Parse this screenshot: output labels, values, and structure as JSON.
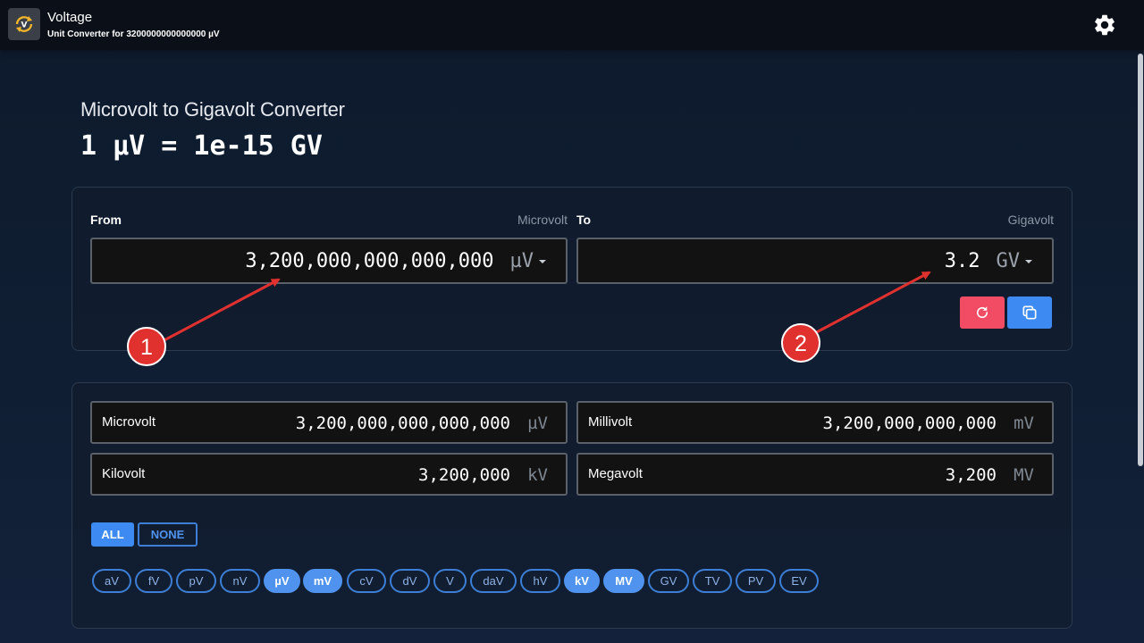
{
  "app": {
    "title": "Voltage",
    "subtitle": "Unit Converter for 3200000000000000 µV",
    "icon": "refresh-bolt-icon"
  },
  "header": {
    "converter_title": "Microvolt to Gigavolt Converter",
    "formula": "1 µV = 1e-15 GV"
  },
  "from": {
    "label": "From",
    "unit_name": "Microvolt",
    "value": "3,200,000,000,000,000",
    "unit": "µV"
  },
  "to": {
    "label": "To",
    "unit_name": "Gigavolt",
    "value": "3.2",
    "unit": "GV"
  },
  "actions": {
    "reset_icon": "reset-icon",
    "copy_icon": "copy-icon",
    "reset_color": "#f24b64",
    "copy_color": "#3d8bf2"
  },
  "results": [
    {
      "name": "Microvolt",
      "value": "3,200,000,000,000,000",
      "unit": "µV"
    },
    {
      "name": "Millivolt",
      "value": "3,200,000,000,000",
      "unit": "mV"
    },
    {
      "name": "Kilovolt",
      "value": "3,200,000",
      "unit": "kV"
    },
    {
      "name": "Megavolt",
      "value": "3,200",
      "unit": "MV"
    }
  ],
  "selection": {
    "all_label": "ALL",
    "none_label": "NONE"
  },
  "chips": [
    {
      "label": "aV",
      "active": false
    },
    {
      "label": "fV",
      "active": false
    },
    {
      "label": "pV",
      "active": false
    },
    {
      "label": "nV",
      "active": false
    },
    {
      "label": "µV",
      "active": true
    },
    {
      "label": "mV",
      "active": true
    },
    {
      "label": "cV",
      "active": false
    },
    {
      "label": "dV",
      "active": false
    },
    {
      "label": "V",
      "active": false
    },
    {
      "label": "daV",
      "active": false
    },
    {
      "label": "hV",
      "active": false
    },
    {
      "label": "kV",
      "active": true
    },
    {
      "label": "MV",
      "active": true
    },
    {
      "label": "GV",
      "active": false
    },
    {
      "label": "TV",
      "active": false
    },
    {
      "label": "PV",
      "active": false
    },
    {
      "label": "EV",
      "active": false
    }
  ],
  "annotations": [
    {
      "label": "1"
    },
    {
      "label": "2"
    }
  ],
  "colors": {
    "accent": "#3d8bf2",
    "annotation_red": "#e0312f",
    "field_bg": "#121212"
  }
}
